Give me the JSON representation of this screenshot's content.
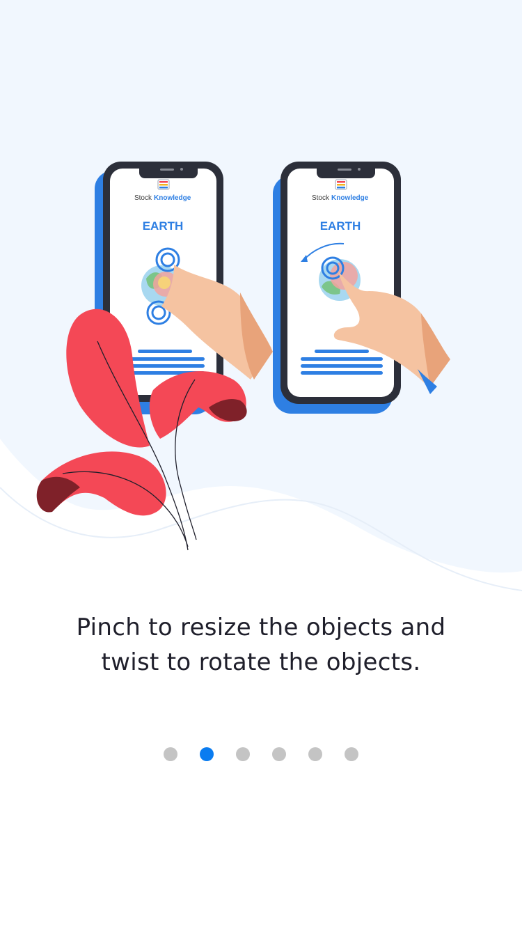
{
  "illustration": {
    "phones": [
      {
        "brand_prefix": "Stock",
        "brand_name": "Knowledge",
        "title": "EARTH"
      },
      {
        "brand_prefix": "Stock",
        "brand_name": "Knowledge",
        "title": "EARTH"
      }
    ]
  },
  "caption": {
    "line1": "Pinch to resize the objects and",
    "line2": "twist to rotate the objects."
  },
  "pagination": {
    "total": 6,
    "active_index": 1
  },
  "colors": {
    "accent": "#0a7cf0",
    "leaf": "#f44856",
    "leaf_dark": "#7f2129",
    "phone_blue": "#2e7fe3",
    "dot_inactive": "#c4c4c4",
    "background_wave": "#f1f7fe"
  }
}
